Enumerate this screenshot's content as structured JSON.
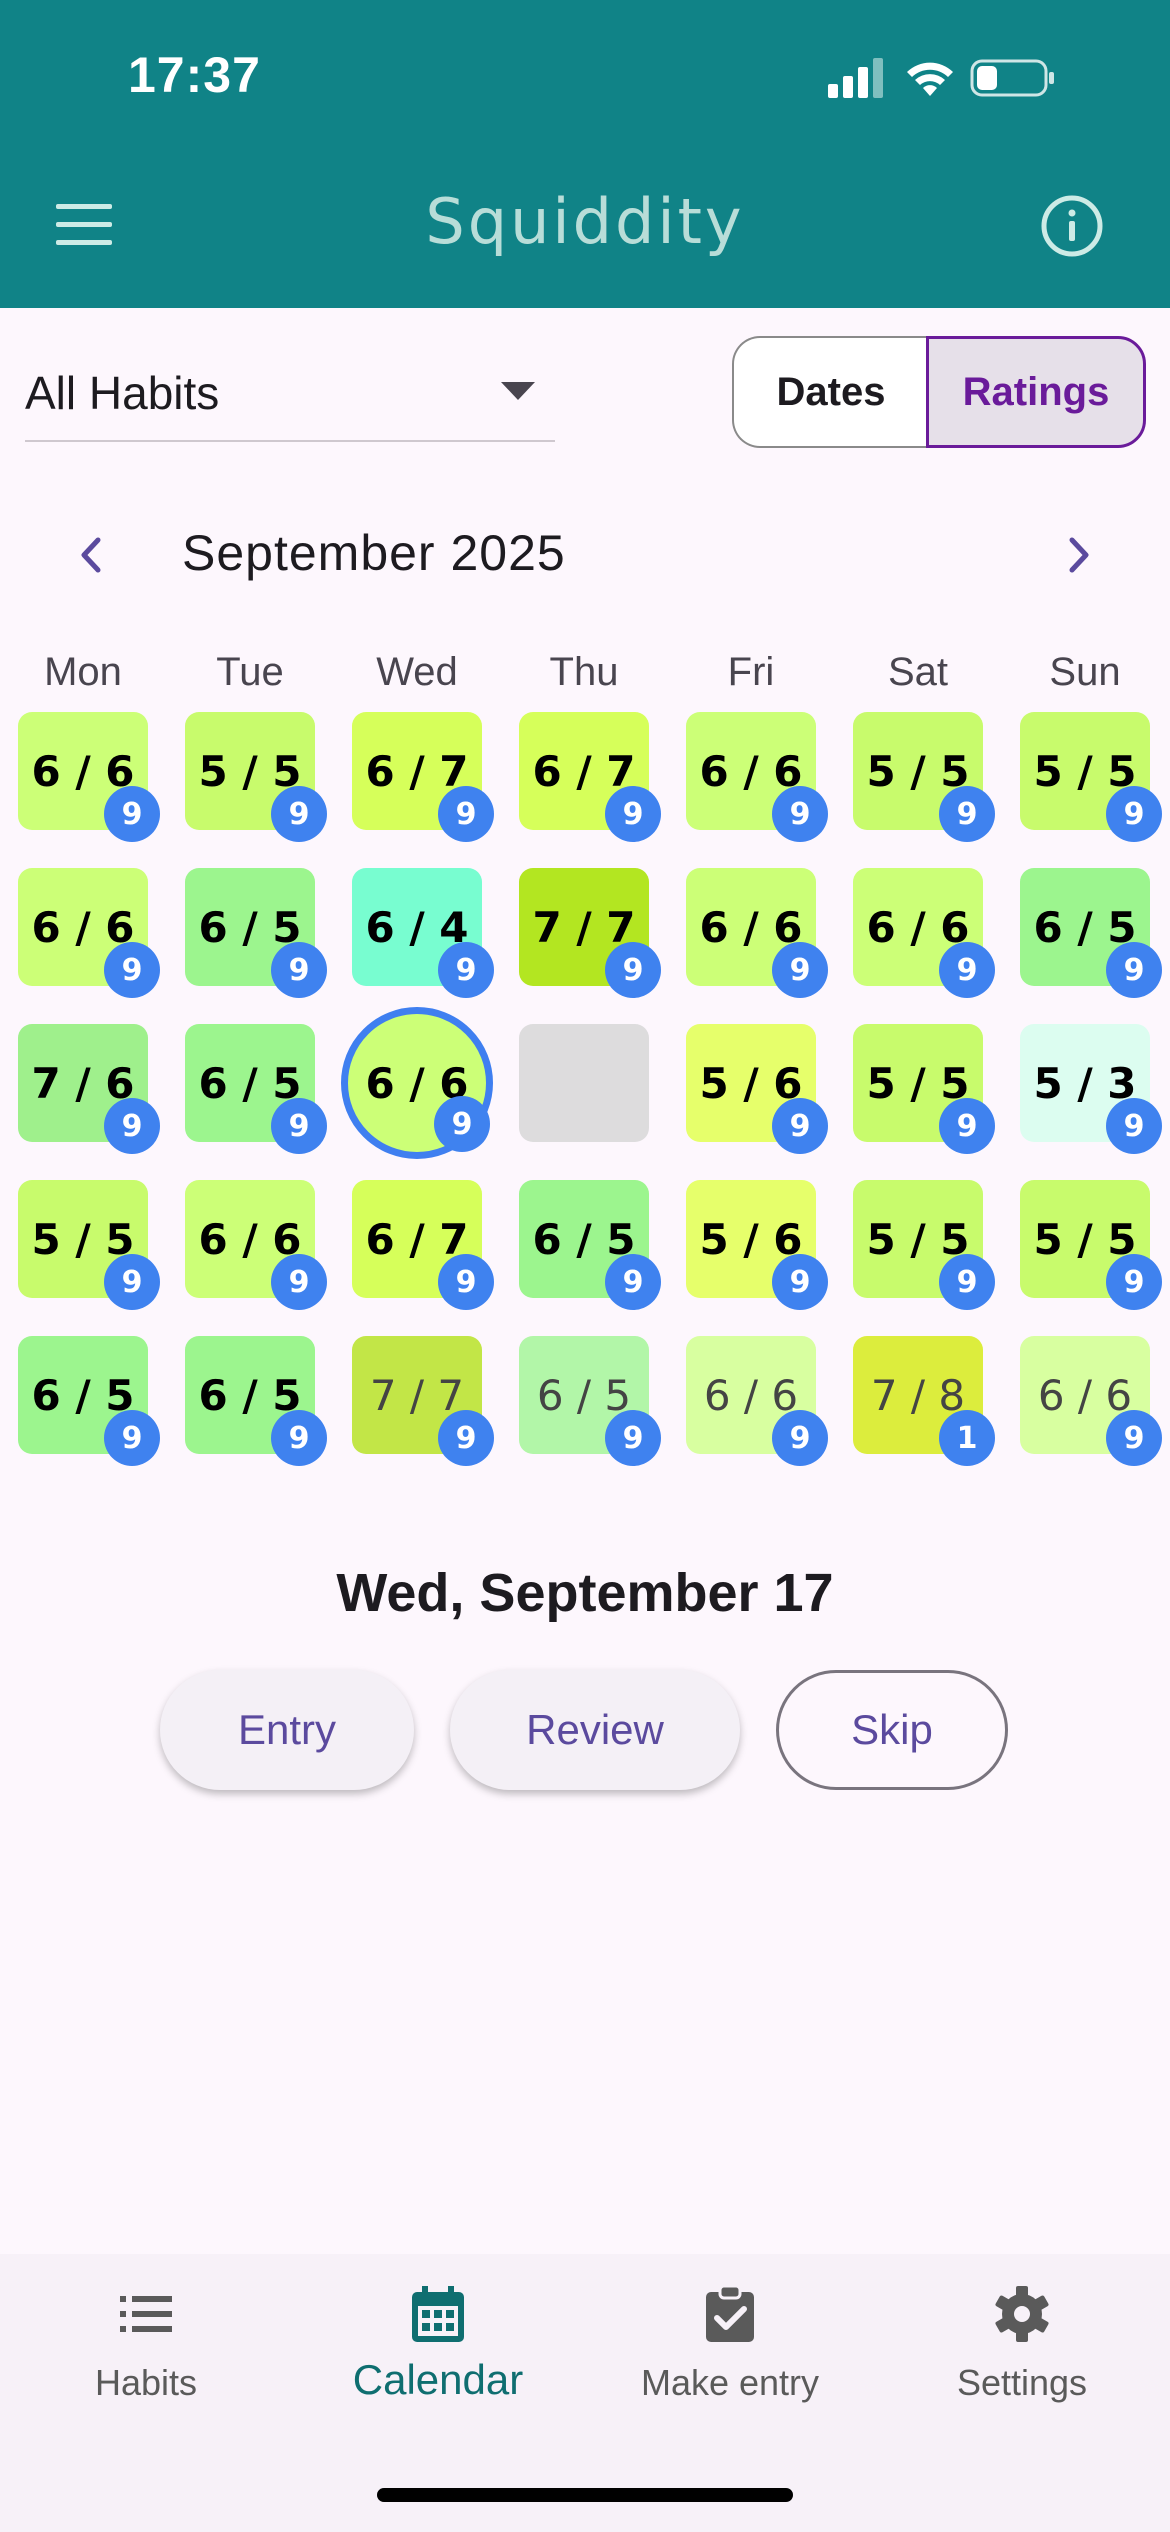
{
  "status_bar": {
    "time": "17:37"
  },
  "app_bar": {
    "title": "Squiddity"
  },
  "filter": {
    "habit_select": "All Habits"
  },
  "view_toggle": {
    "dates": "Dates",
    "ratings": "Ratings",
    "selected": "Ratings"
  },
  "calendar": {
    "month_title": "September 2025",
    "weekdays": [
      "Mon",
      "Tue",
      "Wed",
      "Thu",
      "Fri",
      "Sat",
      "Sun"
    ],
    "weeks": [
      [
        {
          "label": "6 / 6",
          "badge": "9",
          "color": "#ccff77",
          "future": false
        },
        {
          "label": "5 / 5",
          "badge": "9",
          "color": "#c8fb6c",
          "future": false
        },
        {
          "label": "6 / 7",
          "badge": "9",
          "color": "#d6ff5a",
          "future": false
        },
        {
          "label": "6 / 7",
          "badge": "9",
          "color": "#d6ff5a",
          "future": false
        },
        {
          "label": "6 / 6",
          "badge": "9",
          "color": "#ccff77",
          "future": false
        },
        {
          "label": "5 / 5",
          "badge": "9",
          "color": "#c8fb6c",
          "future": false
        },
        {
          "label": "5 / 5",
          "badge": "9",
          "color": "#c8fb6c",
          "future": false
        }
      ],
      [
        {
          "label": "6 / 6",
          "badge": "9",
          "color": "#ccff77",
          "future": false
        },
        {
          "label": "6 / 5",
          "badge": "9",
          "color": "#9cf58e",
          "future": false
        },
        {
          "label": "6 / 4",
          "badge": "9",
          "color": "#78fdd0",
          "future": false
        },
        {
          "label": "7 / 7",
          "badge": "9",
          "color": "#b3e621",
          "future": false
        },
        {
          "label": "6 / 6",
          "badge": "9",
          "color": "#ccff77",
          "future": false
        },
        {
          "label": "6 / 6",
          "badge": "9",
          "color": "#ccff77",
          "future": false
        },
        {
          "label": "6 / 5",
          "badge": "9",
          "color": "#9cf58e",
          "future": false
        }
      ],
      [
        {
          "label": "7 / 6",
          "badge": "9",
          "color": "#9ff08c",
          "future": false
        },
        {
          "label": "6 / 5",
          "badge": "9",
          "color": "#9cf58e",
          "future": false
        },
        {
          "label": "6 / 6",
          "badge": "9",
          "color": "#ccff77",
          "future": false,
          "today": true
        },
        {
          "label": "",
          "badge": "",
          "color": "#dddcdd",
          "future": false
        },
        {
          "label": "5 / 6",
          "badge": "9",
          "color": "#e6ff6b",
          "future": false
        },
        {
          "label": "5 / 5",
          "badge": "9",
          "color": "#c8fb6c",
          "future": false
        },
        {
          "label": "5 / 3",
          "badge": "9",
          "color": "#dcfdf0",
          "future": false
        }
      ],
      [
        {
          "label": "5 / 5",
          "badge": "9",
          "color": "#c8fb6c",
          "future": false
        },
        {
          "label": "6 / 6",
          "badge": "9",
          "color": "#ccff77",
          "future": false
        },
        {
          "label": "6 / 7",
          "badge": "9",
          "color": "#d6ff5a",
          "future": false
        },
        {
          "label": "6 / 5",
          "badge": "9",
          "color": "#9cf58e",
          "future": false
        },
        {
          "label": "5 / 6",
          "badge": "9",
          "color": "#e6ff6b",
          "future": false
        },
        {
          "label": "5 / 5",
          "badge": "9",
          "color": "#c8fb6c",
          "future": false
        },
        {
          "label": "5 / 5",
          "badge": "9",
          "color": "#c8fb6c",
          "future": false
        }
      ],
      [
        {
          "label": "6 / 5",
          "badge": "9",
          "color": "#9cf58e",
          "future": false
        },
        {
          "label": "6 / 5",
          "badge": "9",
          "color": "#9cf58e",
          "future": false
        },
        {
          "label": "7 / 7",
          "badge": "9",
          "color": "#c2e647",
          "future": true
        },
        {
          "label": "6 / 5",
          "badge": "9",
          "color": "#b2f6a8",
          "future": true
        },
        {
          "label": "6 / 6",
          "badge": "9",
          "color": "#d8ffa0",
          "future": true
        },
        {
          "label": "7 / 8",
          "badge": "1",
          "color": "#dced3d",
          "future": true
        },
        {
          "label": "6 / 6",
          "badge": "9",
          "color": "#d8ffa0",
          "future": true
        }
      ]
    ]
  },
  "selected_day": {
    "title": "Wed, September 17"
  },
  "actions": {
    "entry": "Entry",
    "review": "Review",
    "skip": "Skip"
  },
  "bottom_nav": {
    "items": [
      {
        "label": "Habits",
        "icon": "list-icon"
      },
      {
        "label": "Calendar",
        "icon": "calendar-icon",
        "active": true
      },
      {
        "label": "Make entry",
        "icon": "clipboard-check-icon"
      },
      {
        "label": "Settings",
        "icon": "gear-icon"
      }
    ]
  },
  "colors": {
    "header": "#108387",
    "accent": "#6a1b9a",
    "badge": "#3f82ef",
    "active_nav": "#0f6e70"
  }
}
